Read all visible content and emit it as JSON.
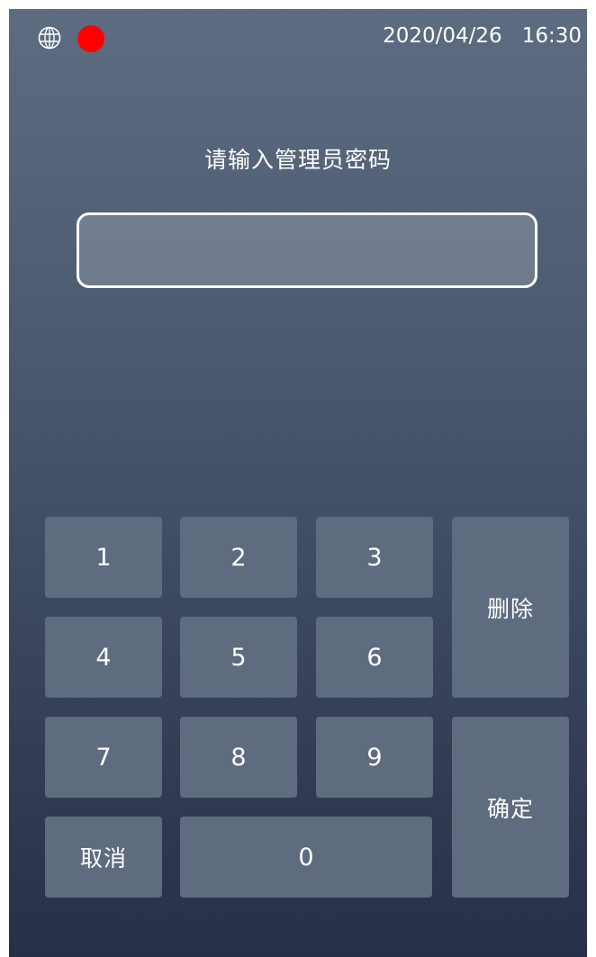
{
  "status_bar": {
    "date": "2020/04/26",
    "time": "16:30",
    "network_icon": "globe-icon",
    "recording_indicator_color": "#ff0000"
  },
  "prompt": "请输入管理员密码",
  "password_field": {
    "value": ""
  },
  "keypad": {
    "k1": "1",
    "k2": "2",
    "k3": "3",
    "k4": "4",
    "k5": "5",
    "k6": "6",
    "k7": "7",
    "k8": "8",
    "k9": "9",
    "k0": "0",
    "delete": "删除",
    "confirm": "确定",
    "cancel": "取消"
  }
}
